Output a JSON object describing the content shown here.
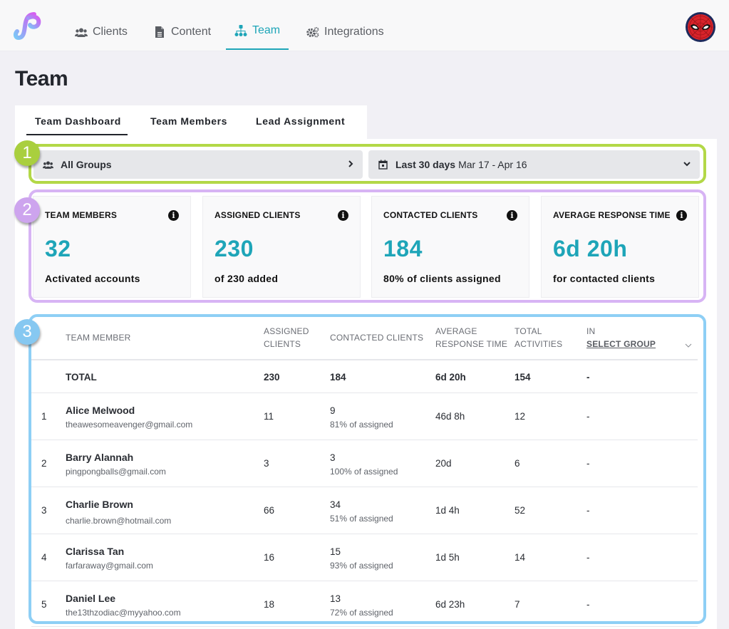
{
  "nav": {
    "items": [
      {
        "label": "Clients",
        "icon": "users-icon",
        "active": false
      },
      {
        "label": "Content",
        "icon": "document-icon",
        "active": false
      },
      {
        "label": "Team",
        "icon": "sitemap-icon",
        "active": true
      },
      {
        "label": "Integrations",
        "icon": "gears-icon",
        "active": false
      }
    ],
    "avatar": "spiderman-avatar"
  },
  "page": {
    "title": "Team"
  },
  "tabs": [
    {
      "label": "Team Dashboard",
      "active": true
    },
    {
      "label": "Team Members",
      "active": false
    },
    {
      "label": "Lead Assignment",
      "active": false
    }
  ],
  "callouts": [
    "1",
    "2",
    "3"
  ],
  "colors": {
    "accent": "#1ea5b8",
    "callout_1": "#b3d847",
    "callout_2": "#d7b4f4",
    "callout_3": "#8ecff5"
  },
  "filters": {
    "group": {
      "label": "All Groups"
    },
    "date": {
      "label": "Last 30 days",
      "range": "Mar 17 - Apr 16"
    }
  },
  "stats": [
    {
      "title": "TEAM MEMBERS",
      "value": "32",
      "desc": "Activated accounts"
    },
    {
      "title": "ASSIGNED CLIENTS",
      "value": "230",
      "desc": "of 230 added"
    },
    {
      "title": "CONTACTED CLIENTS",
      "value": "184",
      "desc": "80% of clients assigned"
    },
    {
      "title": "AVERAGE RESPONSE TIME",
      "value": "6d 20h",
      "desc": "for contacted clients"
    }
  ],
  "table": {
    "headers": {
      "member": "TEAM MEMBER",
      "assigned_1": "ASSIGNED",
      "assigned_2": "CLIENTS",
      "contacted": "CONTACTED CLIENTS",
      "avg_1": "AVERAGE",
      "avg_2": "RESPONSE TIME",
      "act_1": "TOTAL",
      "act_2": "ACTIVITIES",
      "in": "IN",
      "select_group": "SELECT GROUP"
    },
    "total": {
      "label": "TOTAL",
      "assigned": "230",
      "contacted": "184",
      "avg": "6d 20h",
      "activities": "154",
      "group": "-"
    },
    "rows": [
      {
        "idx": "1",
        "name": "Alice Melwood",
        "email": "theawesomeavenger@gmail.com",
        "assigned": "11",
        "contacted": "9",
        "pct": "81% of assigned",
        "avg": "46d 8h",
        "activities": "12",
        "group": "-"
      },
      {
        "idx": "2",
        "name": "Barry Alannah",
        "email": "pingpongballs@gmail.com",
        "assigned": "3",
        "contacted": "3",
        "pct": "100% of assigned",
        "avg": "20d",
        "activities": "6",
        "group": "-"
      },
      {
        "idx": "3",
        "name": "Charlie Brown",
        "email": "charlie.brown@hotmail.com",
        "assigned": "66",
        "contacted": "34",
        "pct": "51% of assigned",
        "avg": "1d 4h",
        "activities": "52",
        "group": "-"
      },
      {
        "idx": "4",
        "name": "Clarissa Tan",
        "email": "farfaraway@gmail.com",
        "assigned": "16",
        "contacted": "15",
        "pct": "93% of assigned",
        "avg": "1d 5h",
        "activities": "14",
        "group": "-"
      },
      {
        "idx": "5",
        "name": "Daniel Lee",
        "email": "the13thzodiac@myyahoo.com",
        "assigned": "18",
        "contacted": "13",
        "pct": "72% of assigned",
        "avg": "6d 23h",
        "activities": "7",
        "group": "-"
      }
    ]
  }
}
